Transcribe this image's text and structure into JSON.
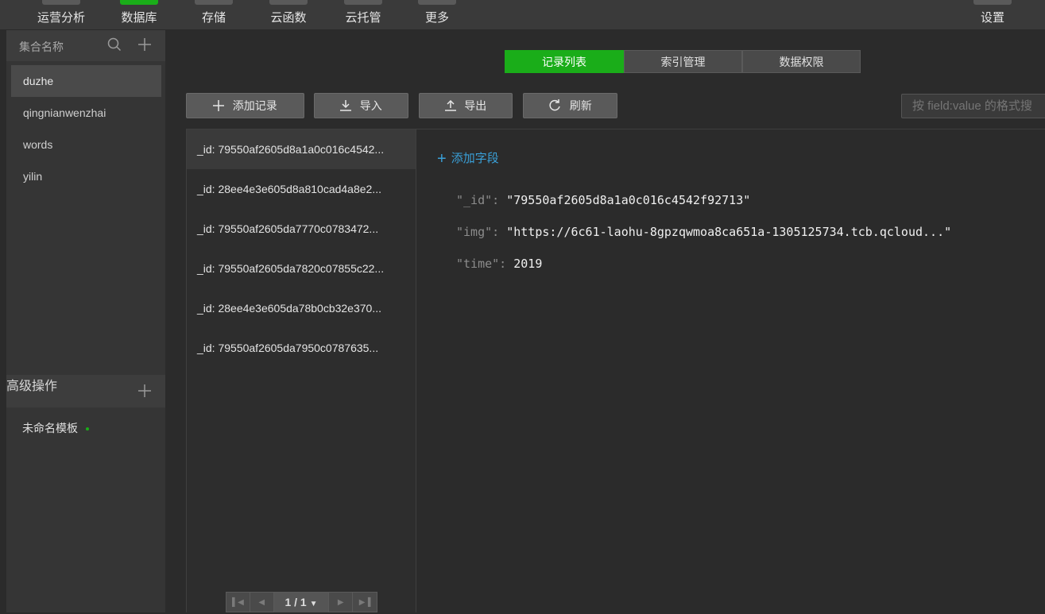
{
  "toolbar": {
    "items": [
      {
        "label": "运营分析"
      },
      {
        "label": "数据库"
      },
      {
        "label": "存储"
      },
      {
        "label": "云函数"
      },
      {
        "label": "云托管"
      },
      {
        "label": "更多"
      }
    ],
    "settings_label": "设置"
  },
  "sidebar": {
    "collections_title": "集合名称",
    "collections": [
      {
        "name": "duzhe"
      },
      {
        "name": "qingnianwenzhai"
      },
      {
        "name": "words"
      },
      {
        "name": "yilin"
      }
    ],
    "advanced_title": "高级操作",
    "advanced_item": "未命名模板"
  },
  "tabs": [
    {
      "label": "记录列表"
    },
    {
      "label": "索引管理"
    },
    {
      "label": "数据权限"
    }
  ],
  "actions": {
    "add_record": "添加记录",
    "import": "导入",
    "export": "导出",
    "refresh": "刷新",
    "search_placeholder": "按 field:value 的格式搜"
  },
  "records": [
    {
      "label": "_id: 79550af2605d8a1a0c016c4542..."
    },
    {
      "label": "_id: 28ee4e3e605d8a810cad4a8e2..."
    },
    {
      "label": "_id: 79550af2605da7770c0783472..."
    },
    {
      "label": "_id: 79550af2605da7820c07855c22..."
    },
    {
      "label": "_id: 28ee4e3e605da78b0cb32e370..."
    },
    {
      "label": "_id: 79550af2605da7950c0787635..."
    }
  ],
  "pagination": {
    "label": "1 / 1"
  },
  "detail": {
    "add_field": "添加字段",
    "fields": [
      {
        "key": "\"_id\":",
        "value": "\"79550af2605d8a1a0c016c4542f92713\""
      },
      {
        "key": "\"img\":",
        "value": "\"https://6c61-laohu-8gpzqwmoa8ca651a-1305125734.tcb.qcloud...\""
      },
      {
        "key": "\"time\":",
        "value": "2019"
      }
    ]
  },
  "colors": {
    "accent": "#1aad19",
    "link": "#3aa0d8"
  }
}
